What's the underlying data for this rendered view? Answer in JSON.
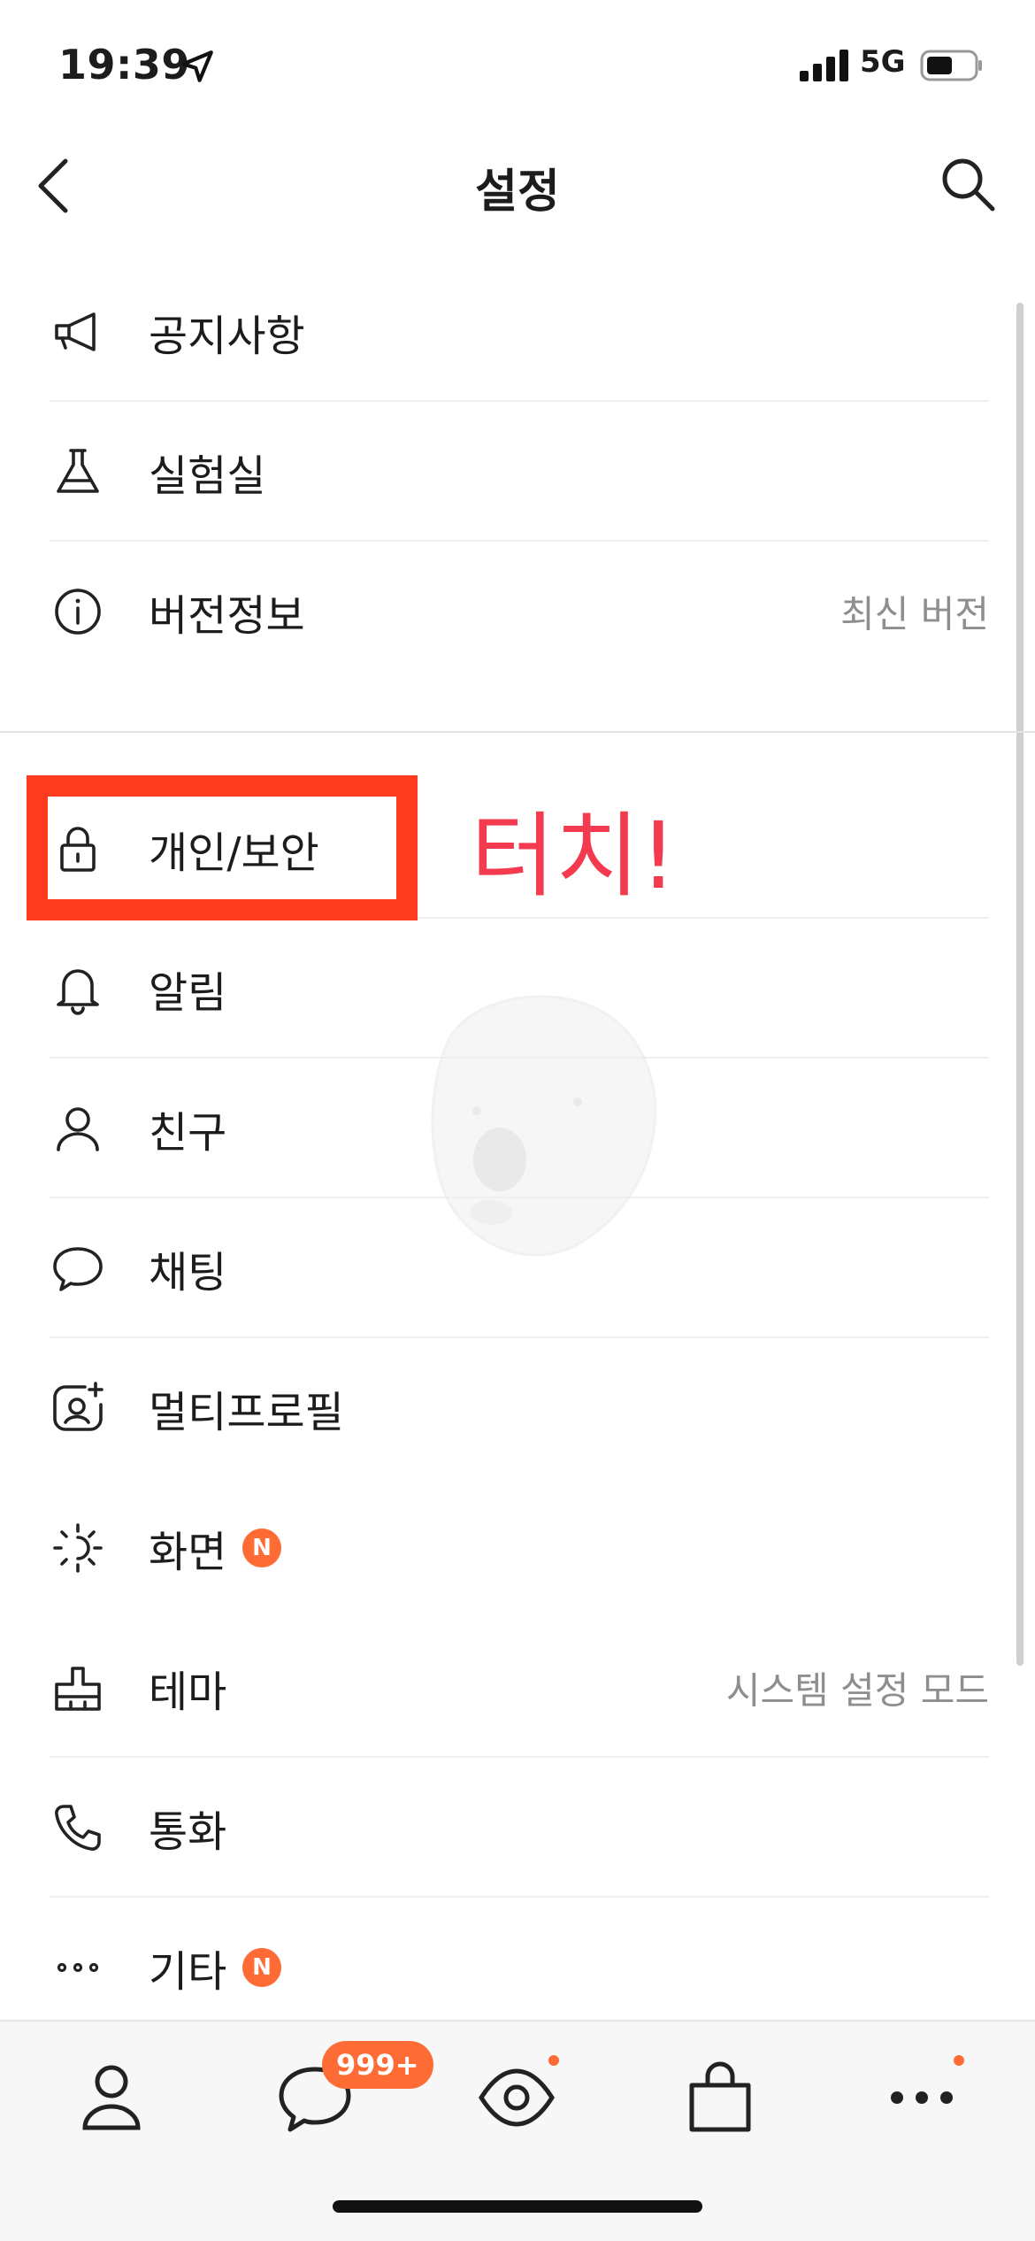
{
  "status_bar": {
    "time": "19:39",
    "network": "5G",
    "icons": [
      "location-arrow-icon",
      "cellular-signal-icon",
      "battery-icon"
    ]
  },
  "nav": {
    "title": "설정",
    "back_icon": "chevron-left-icon",
    "search_icon": "search-icon"
  },
  "settings": {
    "group1": [
      {
        "label": "공지사항",
        "icon": "megaphone-icon"
      },
      {
        "label": "실험실",
        "icon": "flask-icon"
      },
      {
        "label": "버전정보",
        "icon": "info-icon",
        "value": "최신 버전"
      }
    ],
    "group2": [
      {
        "label": "개인/보안",
        "icon": "lock-icon"
      },
      {
        "label": "알림",
        "icon": "bell-icon"
      },
      {
        "label": "친구",
        "icon": "person-icon"
      },
      {
        "label": "채팅",
        "icon": "chat-bubble-icon"
      },
      {
        "label": "멀티프로필",
        "icon": "multi-profile-icon"
      },
      {
        "label": "화면",
        "icon": "brightness-icon",
        "badge": "N"
      },
      {
        "label": "테마",
        "icon": "theme-brush-icon",
        "value": "시스템 설정 모드"
      },
      {
        "label": "통화",
        "icon": "phone-icon"
      },
      {
        "label": "기타",
        "icon": "more-dots-icon",
        "badge": "N"
      }
    ]
  },
  "annotation": {
    "text": "터치!",
    "color": "#f43a4f",
    "highlight_color": "#ff3b1f"
  },
  "tab_bar": {
    "tabs": [
      {
        "name": "friends",
        "icon": "person-icon"
      },
      {
        "name": "chats",
        "icon": "chat-bubble-icon",
        "badge": "999+"
      },
      {
        "name": "view",
        "icon": "eye-icon",
        "dot": true
      },
      {
        "name": "shopping",
        "icon": "shopping-bag-icon"
      },
      {
        "name": "more",
        "icon": "more-dots-icon",
        "dot": true
      }
    ]
  },
  "colors": {
    "accent": "#ff6b35",
    "text": "#1c1c1c",
    "secondary_text": "#8e8e8e"
  }
}
